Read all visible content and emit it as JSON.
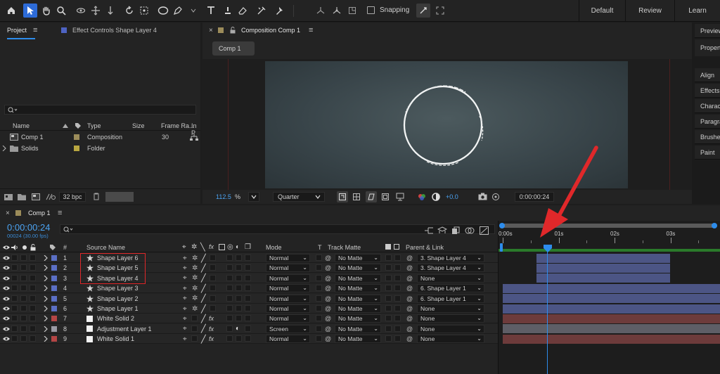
{
  "workspaces": [
    "Default",
    "Review",
    "Learn"
  ],
  "toolbar": {
    "snapping_label": "Snapping"
  },
  "project_panel": {
    "tab_project": "Project",
    "tab_effect_controls": "Effect Controls Shape Layer 4",
    "columns": [
      "Name",
      "Type",
      "Size",
      "Frame Ra...",
      "In P"
    ],
    "items": [
      {
        "name": "Comp 1",
        "type": "Composition",
        "size": "",
        "frame_rate": "30",
        "label_color": "#9c8c5a"
      },
      {
        "name": "Solids",
        "type": "Folder",
        "size": "",
        "frame_rate": "",
        "label_color": "#b8a640"
      }
    ],
    "bpc": "32 bpc"
  },
  "composition_panel": {
    "tab_title": "Composition Comp 1",
    "sub_tab": "Comp 1",
    "zoom": "112.5",
    "zoom_unit": "%",
    "resolution": "Quarter",
    "exposure": "+0.0",
    "timecode": "0:00:00:24"
  },
  "right_panel": {
    "items": [
      "Preview",
      "Properties",
      "Align",
      "Effects",
      "Character",
      "Paragraph",
      "Brushes",
      "Paint"
    ]
  },
  "timeline": {
    "tab_title": "Comp 1",
    "timecode": "0:00:00:24",
    "frame_info": "00024 (30.00 fps)",
    "col_headers": {
      "number": "#",
      "source_name": "Source Name",
      "mode": "Mode",
      "t": "T",
      "track_matte": "Track Matte",
      "parent": "Parent & Link"
    },
    "ruler_labels": [
      "0:00s",
      "01s",
      "02s",
      "03s"
    ],
    "layers": [
      {
        "num": "1",
        "name": "Shape Layer 6",
        "type": "shape",
        "label": "#5b6fc4",
        "mode": "Normal",
        "matte": "No Matte",
        "parent": "3. Shape Layer 4",
        "bar": "#4c5585",
        "bar_start": 0.6,
        "bar_end": 3.0
      },
      {
        "num": "2",
        "name": "Shape Layer 5",
        "type": "shape",
        "label": "#5b6fc4",
        "mode": "Normal",
        "matte": "No Matte",
        "parent": "3. Shape Layer 4",
        "bar": "#4c5585",
        "bar_start": 0.6,
        "bar_end": 3.0
      },
      {
        "num": "3",
        "name": "Shape Layer 4",
        "type": "shape",
        "label": "#5b6fc4",
        "mode": "Normal",
        "matte": "No Matte",
        "parent": "None",
        "bar": "#4c5585",
        "bar_start": 0.6,
        "bar_end": 3.0
      },
      {
        "num": "4",
        "name": "Shape Layer 3",
        "type": "shape",
        "label": "#5b6fc4",
        "mode": "Normal",
        "matte": "No Matte",
        "parent": "6. Shape Layer 1",
        "bar": "#4c5585",
        "bar_start": 0,
        "bar_end": 4
      },
      {
        "num": "5",
        "name": "Shape Layer 2",
        "type": "shape",
        "label": "#5b6fc4",
        "mode": "Normal",
        "matte": "No Matte",
        "parent": "6. Shape Layer 1",
        "bar": "#4c5585",
        "bar_start": 0,
        "bar_end": 4
      },
      {
        "num": "6",
        "name": "Shape Layer 1",
        "type": "shape",
        "label": "#5b6fc4",
        "mode": "Normal",
        "matte": "No Matte",
        "parent": "None",
        "bar": "#4c5585",
        "bar_start": 0,
        "bar_end": 4
      },
      {
        "num": "7",
        "name": "White Solid 2",
        "type": "solid",
        "label": "#b44646",
        "mode": "Normal",
        "matte": "No Matte",
        "parent": "None",
        "bar": "#6d3b3b",
        "bar_start": 0,
        "bar_end": 4
      },
      {
        "num": "8",
        "name": "Adjustment Layer 1",
        "type": "adjustment",
        "label": "#9a9aa4",
        "mode": "Screen",
        "matte": "No Matte",
        "parent": "None",
        "bar": "#5e5e66",
        "bar_start": 0,
        "bar_end": 4
      },
      {
        "num": "9",
        "name": "White Solid 1",
        "type": "solid",
        "label": "#b44646",
        "mode": "Normal",
        "matte": "No Matte",
        "parent": "None",
        "bar": "#6d3b3b",
        "bar_start": 0,
        "bar_end": 4
      }
    ],
    "playhead_time": 0.8,
    "highlight_color": "#e0282a",
    "accent_color": "#2d8ceb"
  }
}
